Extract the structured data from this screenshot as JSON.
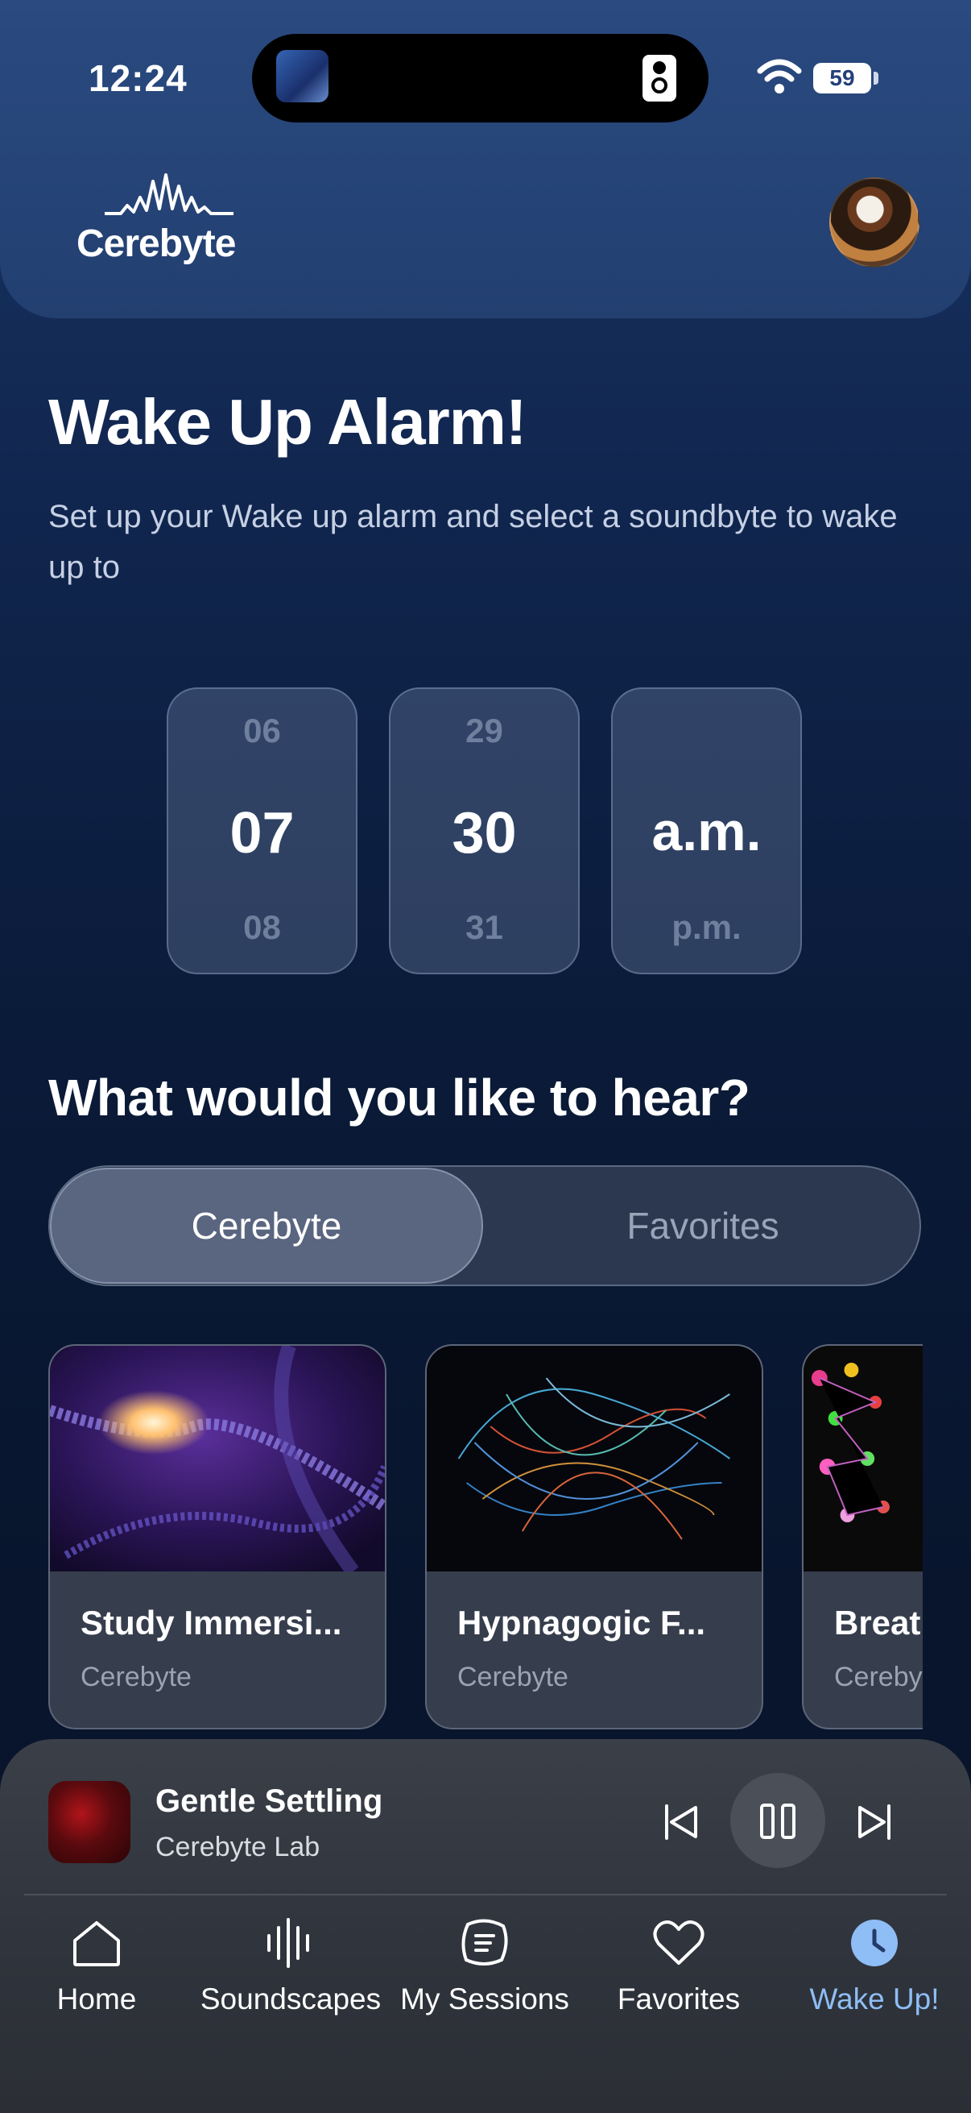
{
  "status_bar": {
    "time": "12:24",
    "battery": "59"
  },
  "header": {
    "logo_text": "Cerebyte"
  },
  "page": {
    "title": "Wake Up Alarm!",
    "subtitle": "Set up your Wake up alarm and select a soundbyte to wake up to"
  },
  "time_picker": {
    "hour": {
      "prev": "06",
      "current": "07",
      "next": "08"
    },
    "minute": {
      "prev": "29",
      "current": "30",
      "next": "31"
    },
    "period": {
      "prev": "",
      "current": "a.m.",
      "next": "p.m."
    }
  },
  "sound_section": {
    "heading": "What would you like to hear?",
    "tabs": [
      {
        "label": "Cerebyte",
        "selected": true
      },
      {
        "label": "Favorites",
        "selected": false
      }
    ],
    "cards": [
      {
        "title": "Study Immersi...",
        "subtitle": "Cerebyte"
      },
      {
        "title": "Hypnagogic F...",
        "subtitle": "Cerebyte"
      },
      {
        "title": "Breat",
        "subtitle": "Cereby"
      }
    ]
  },
  "now_playing": {
    "title": "Gentle Settling",
    "artist": "Cerebyte Lab"
  },
  "nav": [
    {
      "label": "Home",
      "icon": "home-icon"
    },
    {
      "label": "Soundscapes",
      "icon": "soundwave-icon"
    },
    {
      "label": "My Sessions",
      "icon": "sessions-icon"
    },
    {
      "label": "Favorites",
      "icon": "heart-icon"
    },
    {
      "label": "Wake Up!",
      "icon": "clock-icon",
      "active": true
    }
  ],
  "colors": {
    "accent": "#8fbdf5",
    "background": "#0a1a38"
  }
}
